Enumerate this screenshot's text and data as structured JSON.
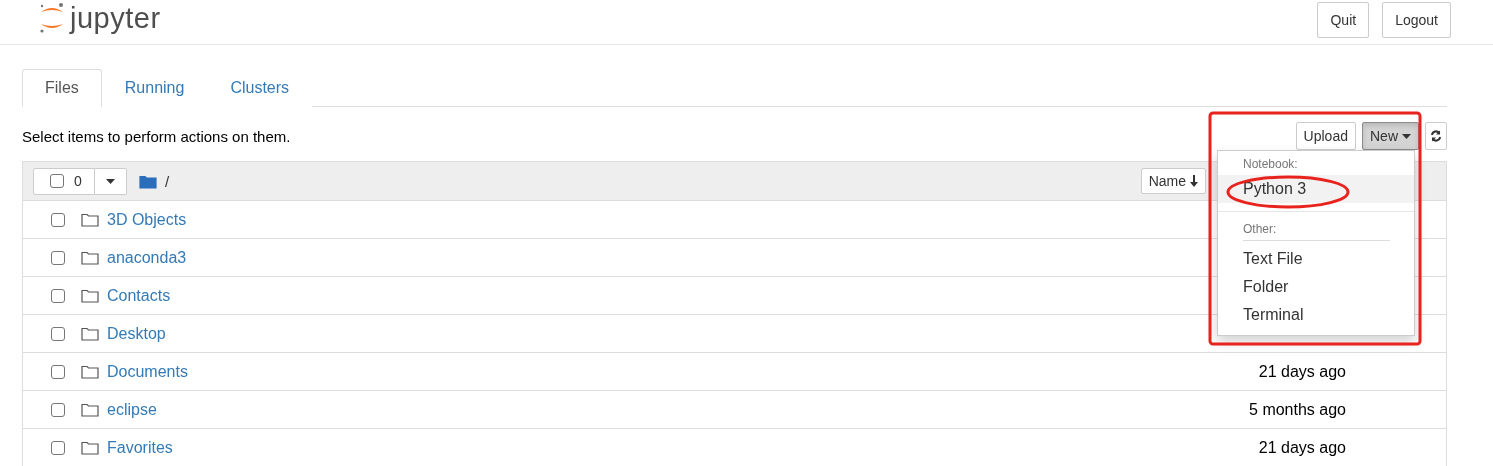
{
  "header": {
    "logo_text": "jupyter",
    "buttons": [
      "Quit",
      "Logout"
    ]
  },
  "tabs": [
    {
      "label": "Files",
      "selected": true
    },
    {
      "label": "Running",
      "selected": false
    },
    {
      "label": "Clusters",
      "selected": false
    }
  ],
  "toolbar": {
    "hint": "Select items to perform actions on them.",
    "upload": "Upload",
    "new": {
      "label": "New",
      "active": true
    }
  },
  "list_header": {
    "count": "0",
    "path": "/",
    "sort": "Name"
  },
  "rows": [
    {
      "name": "3D Objects",
      "checked": false,
      "modified": ""
    },
    {
      "name": "anaconda3",
      "checked": false,
      "modified": ""
    },
    {
      "name": "Contacts",
      "checked": false,
      "modified": ""
    },
    {
      "name": "Desktop",
      "checked": false,
      "modified": ""
    },
    {
      "name": "Documents",
      "checked": false,
      "modified": "21 days ago"
    },
    {
      "name": "eclipse",
      "checked": false,
      "modified": "5 months ago"
    },
    {
      "name": "Favorites",
      "checked": false,
      "modified": "21 days ago"
    }
  ],
  "new_menu": [
    {
      "header": "Notebook:",
      "items": [
        {
          "label": "Python 3",
          "highlighted": true
        }
      ]
    },
    {
      "header": "Other:",
      "items": [
        {
          "label": "Text File",
          "highlighted": false
        },
        {
          "label": "Folder",
          "highlighted": false
        },
        {
          "label": "Terminal",
          "highlighted": false
        }
      ]
    }
  ]
}
